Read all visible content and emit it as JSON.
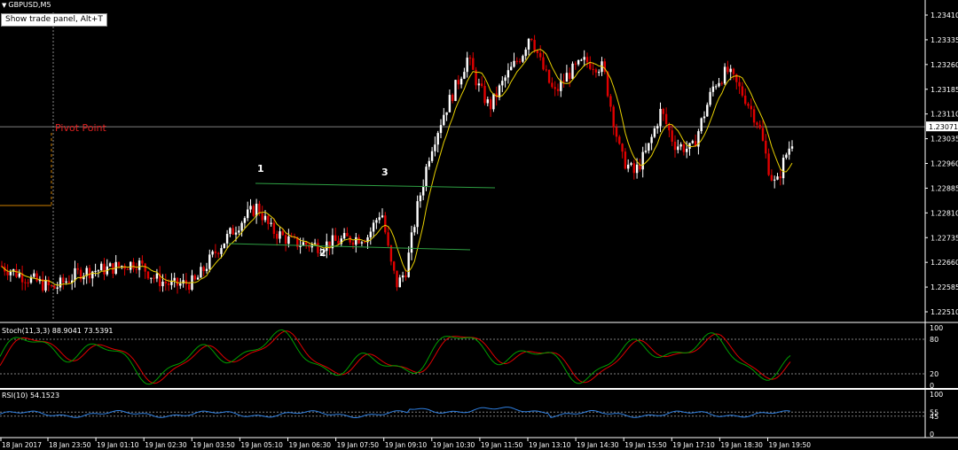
{
  "window": {
    "symbol_title": "GBPUSD,M5",
    "trade_panel_button": "Show trade panel, Alt+T"
  },
  "main_chart": {
    "annotation_label": "Pivot Point",
    "wave_labels": [
      "1",
      "2",
      "3"
    ],
    "price_levels": [
      "1.23410",
      "1.23335",
      "1.23260",
      "1.23185",
      "1.23110",
      "1.23035",
      "1.22960",
      "1.22885",
      "1.22810",
      "1.22735",
      "1.22660",
      "1.22585",
      "1.22510"
    ],
    "current_price": "1.23071"
  },
  "stoch_panel": {
    "label": "Stoch(11,3,3) 88.9041 73.5391",
    "levels": [
      "100",
      "80",
      "20",
      "0"
    ]
  },
  "rsi_panel": {
    "label": "RSI(10) 54.1523",
    "levels": [
      "100",
      "55",
      "45",
      "0"
    ]
  },
  "time_axis": {
    "labels": [
      "18 Jan 2017",
      "18 Jan 23:50",
      "19 Jan 01:10",
      "19 Jan 02:30",
      "19 Jan 03:50",
      "19 Jan 05:10",
      "19 Jan 06:30",
      "19 Jan 07:50",
      "19 Jan 09:10",
      "19 Jan 10:30",
      "19 Jan 11:50",
      "19 Jan 13:10",
      "19 Jan 14:30",
      "19 Jan 15:50",
      "19 Jan 17:10",
      "19 Jan 18:30",
      "19 Jan 19:50"
    ]
  },
  "colors": {
    "bull_candle": "#ffffff",
    "bear_candle": "#e00000",
    "moving_average": "#e8d000",
    "trendline": "#2ea043",
    "stoch_main": "#00a000",
    "stoch_signal": "#e00000",
    "rsi_line": "#2f7fe0",
    "pivot": "#e02020",
    "pivot_marker": "#d08000",
    "grid": "#808080"
  }
}
